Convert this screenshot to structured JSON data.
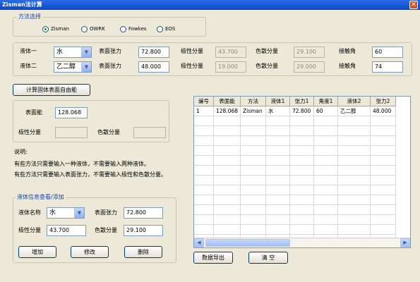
{
  "window": {
    "title": "Zisman法计算",
    "close_glyph": "✕"
  },
  "method_group": {
    "title": "方法选择",
    "options": [
      "Zisman",
      "OWRK",
      "Fowkes",
      "EOS"
    ],
    "selected": "Zisman"
  },
  "liquids": {
    "row1": {
      "label": "液体一",
      "liquid": "水",
      "surface_tension_label": "表面张力",
      "surface_tension": "72.800",
      "polar_label": "极性分量",
      "polar": "43.700",
      "dispersive_label": "色散分量",
      "dispersive": "29.100",
      "contact_angle_label": "接触角",
      "contact_angle": "60"
    },
    "row2": {
      "label": "液体二",
      "liquid": "乙二醇",
      "surface_tension_label": "表面张力",
      "surface_tension": "48.000",
      "polar_label": "极性分量",
      "polar": "19.000",
      "dispersive_label": "色散分量",
      "dispersive": "29.000",
      "contact_angle_label": "接触角",
      "contact_angle": "74"
    }
  },
  "calc_button": "计算固体表面自由能",
  "result": {
    "surface_energy_label": "表面能",
    "surface_energy": "128.068",
    "polar_label": "极性分量",
    "polar": "",
    "dispersive_label": "色散分量",
    "dispersive": ""
  },
  "notes": {
    "heading": "说明:",
    "line1": "有些方法只需要输入一种液体，不需要输入两种液体。",
    "line2": "有些方法只需要输入表面张力，不需要输入极性和色散分量。"
  },
  "liquid_edit": {
    "title": "液体信息查看/添加",
    "name_label": "液体名称",
    "name": "水",
    "surface_tension_label": "表面张力",
    "surface_tension": "72.800",
    "polar_label": "极性分量",
    "polar": "43.700",
    "dispersive_label": "色散分量",
    "dispersive": "29.100",
    "add_button": "增加",
    "modify_button": "修改",
    "delete_button": "删除"
  },
  "table": {
    "headers": [
      "编号",
      "表面能",
      "方法",
      "液体1",
      "张力1",
      "角度1",
      "液体2",
      "张力2"
    ],
    "rows": [
      [
        "1",
        "128.068",
        "Zisman",
        "水",
        "72.800",
        "60",
        "乙二醇",
        "48.000"
      ]
    ]
  },
  "export_button": "数据导出",
  "clear_button": "清 空"
}
